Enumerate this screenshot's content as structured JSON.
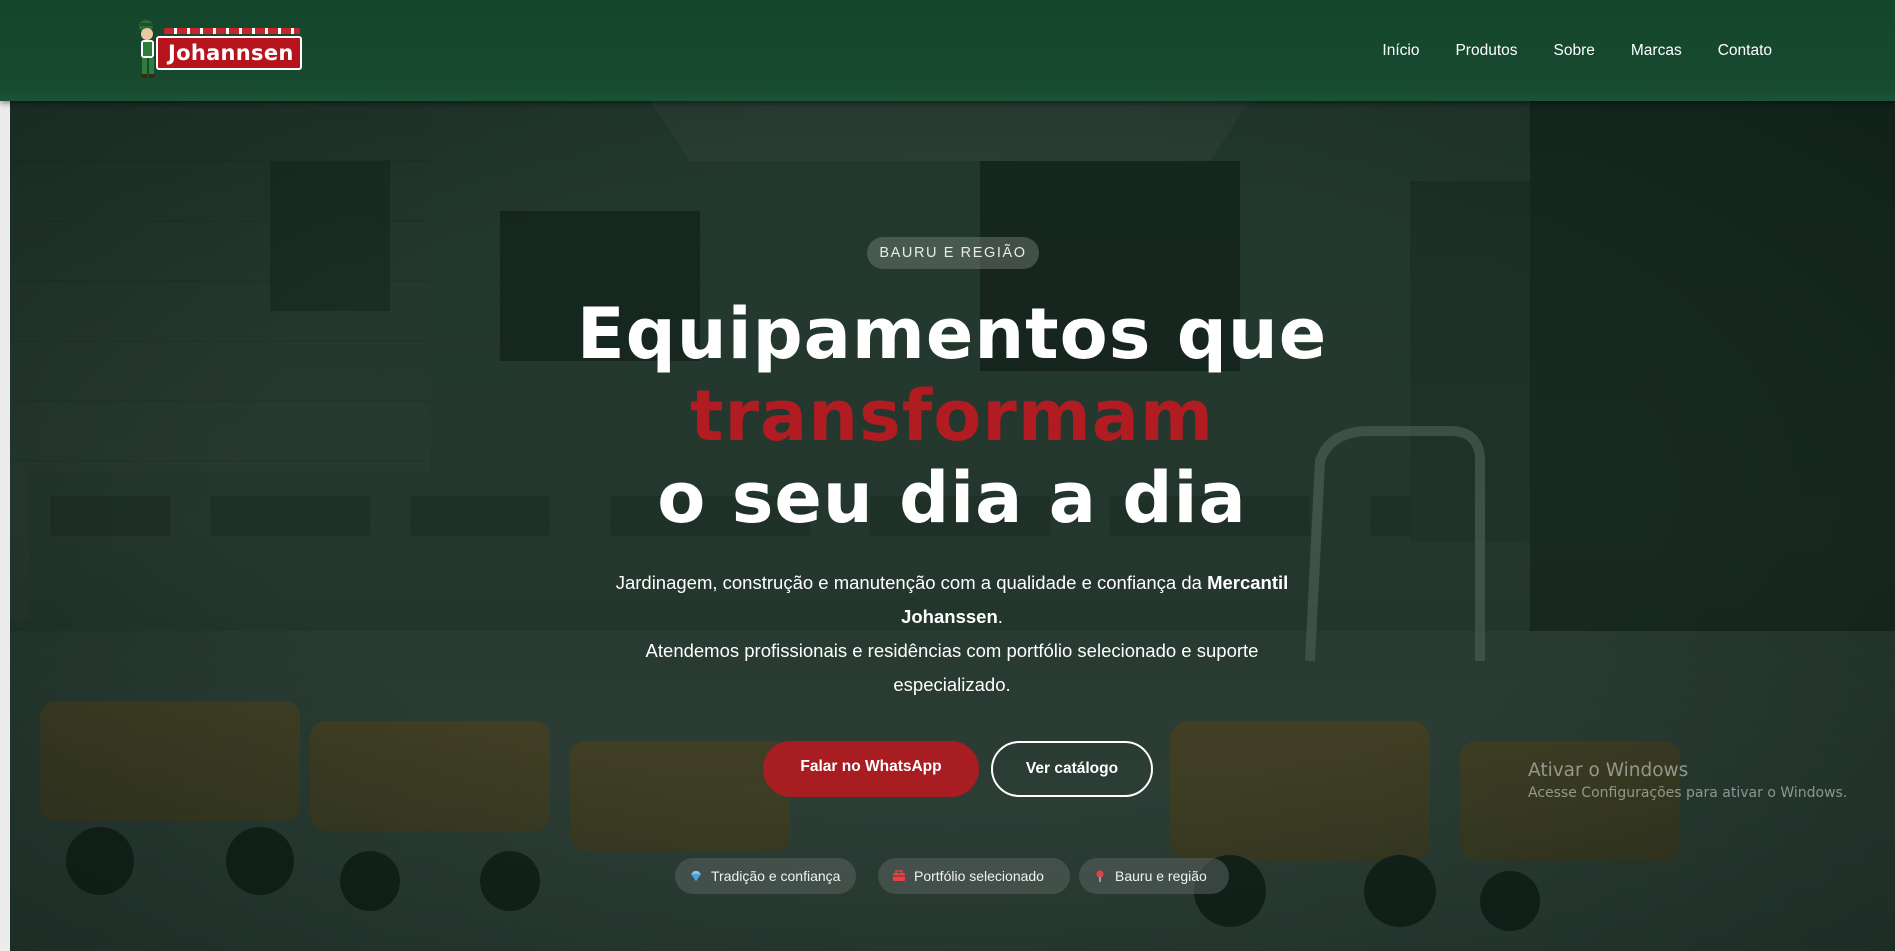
{
  "brand": {
    "logo_text": "Johannsen",
    "colors": {
      "header_green": "#174a2f",
      "accent_red": "#a81d22",
      "headline_accent": "#b11c22"
    }
  },
  "nav": {
    "items": [
      "Início",
      "Produtos",
      "Sobre",
      "Marcas",
      "Contato"
    ]
  },
  "hero": {
    "badge": "BAURU E REGIÃO",
    "headline": {
      "line1": "Equipamentos que",
      "accent": "transformam",
      "line3": "o seu dia a dia"
    },
    "description": {
      "part1": "Jardinagem, construção e manutenção com a qualidade e confiança da ",
      "brand_bold": "Mercantil Johanssen",
      "part2": ".",
      "line2": "Atendemos profissionais e residências com portfólio selecionado e suporte especializado."
    },
    "buttons": {
      "primary": "Falar no WhatsApp",
      "secondary": "Ver catálogo"
    },
    "pills": [
      {
        "label": "Tradição e confiança",
        "icon": "diamond-icon"
      },
      {
        "label": "Portfólio selecionado",
        "icon": "toolbox-icon"
      },
      {
        "label": "Bauru e região",
        "icon": "pin-icon"
      }
    ]
  },
  "os_watermark": {
    "title": "Ativar o Windows",
    "subtitle": "Acesse Configurações para ativar o Windows."
  }
}
